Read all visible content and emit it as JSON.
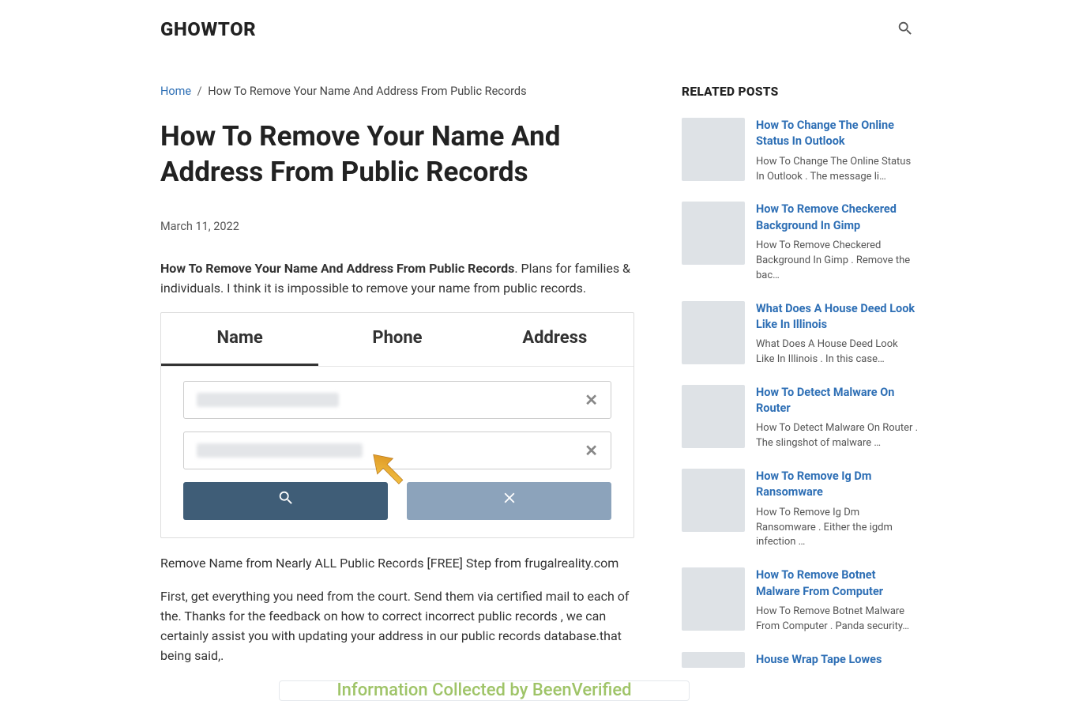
{
  "header": {
    "logo": "GHOWTOR"
  },
  "breadcrumb": {
    "home": "Home",
    "sep": "/",
    "current": "How To Remove Your Name And Address From Public Records"
  },
  "post": {
    "title": "How To Remove Your Name And Address From Public Records",
    "date": "March 11, 2022",
    "lead_strong": "How To Remove Your Name And Address From Public Records",
    "lead_rest": ". Plans for families & individuals. I think it is impossible to remove your name from public records.",
    "caption": "Remove Name from Nearly ALL Public Records [FREE] Step from frugalreality.com",
    "body2": "First, get everything you need from the court. Send them via certified mail to each of the. Thanks for the feedback on how to correct incorrect public records , we can certainly assist you with updating your address in our public records database.that being said,."
  },
  "figure": {
    "tabs": [
      "Name",
      "Phone",
      "Address"
    ]
  },
  "fig2": {
    "text_fragment": "Information Collected by BeenVerified"
  },
  "sidebar": {
    "title": "RELATED POSTS",
    "items": [
      {
        "title": "How To Change The Online Status In Outlook",
        "excerpt": "How To Change The Online Status In Outlook . The message li…"
      },
      {
        "title": "How To Remove Checkered Background In Gimp",
        "excerpt": "How To Remove Checkered Background In Gimp . Remove the bac…"
      },
      {
        "title": "What Does A House Deed Look Like In Illinois",
        "excerpt": "What Does A House Deed Look Like In Illinois . In this case…"
      },
      {
        "title": "How To Detect Malware On Router",
        "excerpt": "How To Detect Malware On Router . The slingshot of malware …"
      },
      {
        "title": "How To Remove Ig Dm Ransomware",
        "excerpt": "How To Remove Ig Dm Ransomware . Either the igdm infection …"
      },
      {
        "title": "How To Remove Botnet Malware From Computer",
        "excerpt": "How To Remove Botnet Malware From Computer . Panda security…"
      },
      {
        "title": "House Wrap Tape Lowes",
        "excerpt": ""
      }
    ]
  }
}
